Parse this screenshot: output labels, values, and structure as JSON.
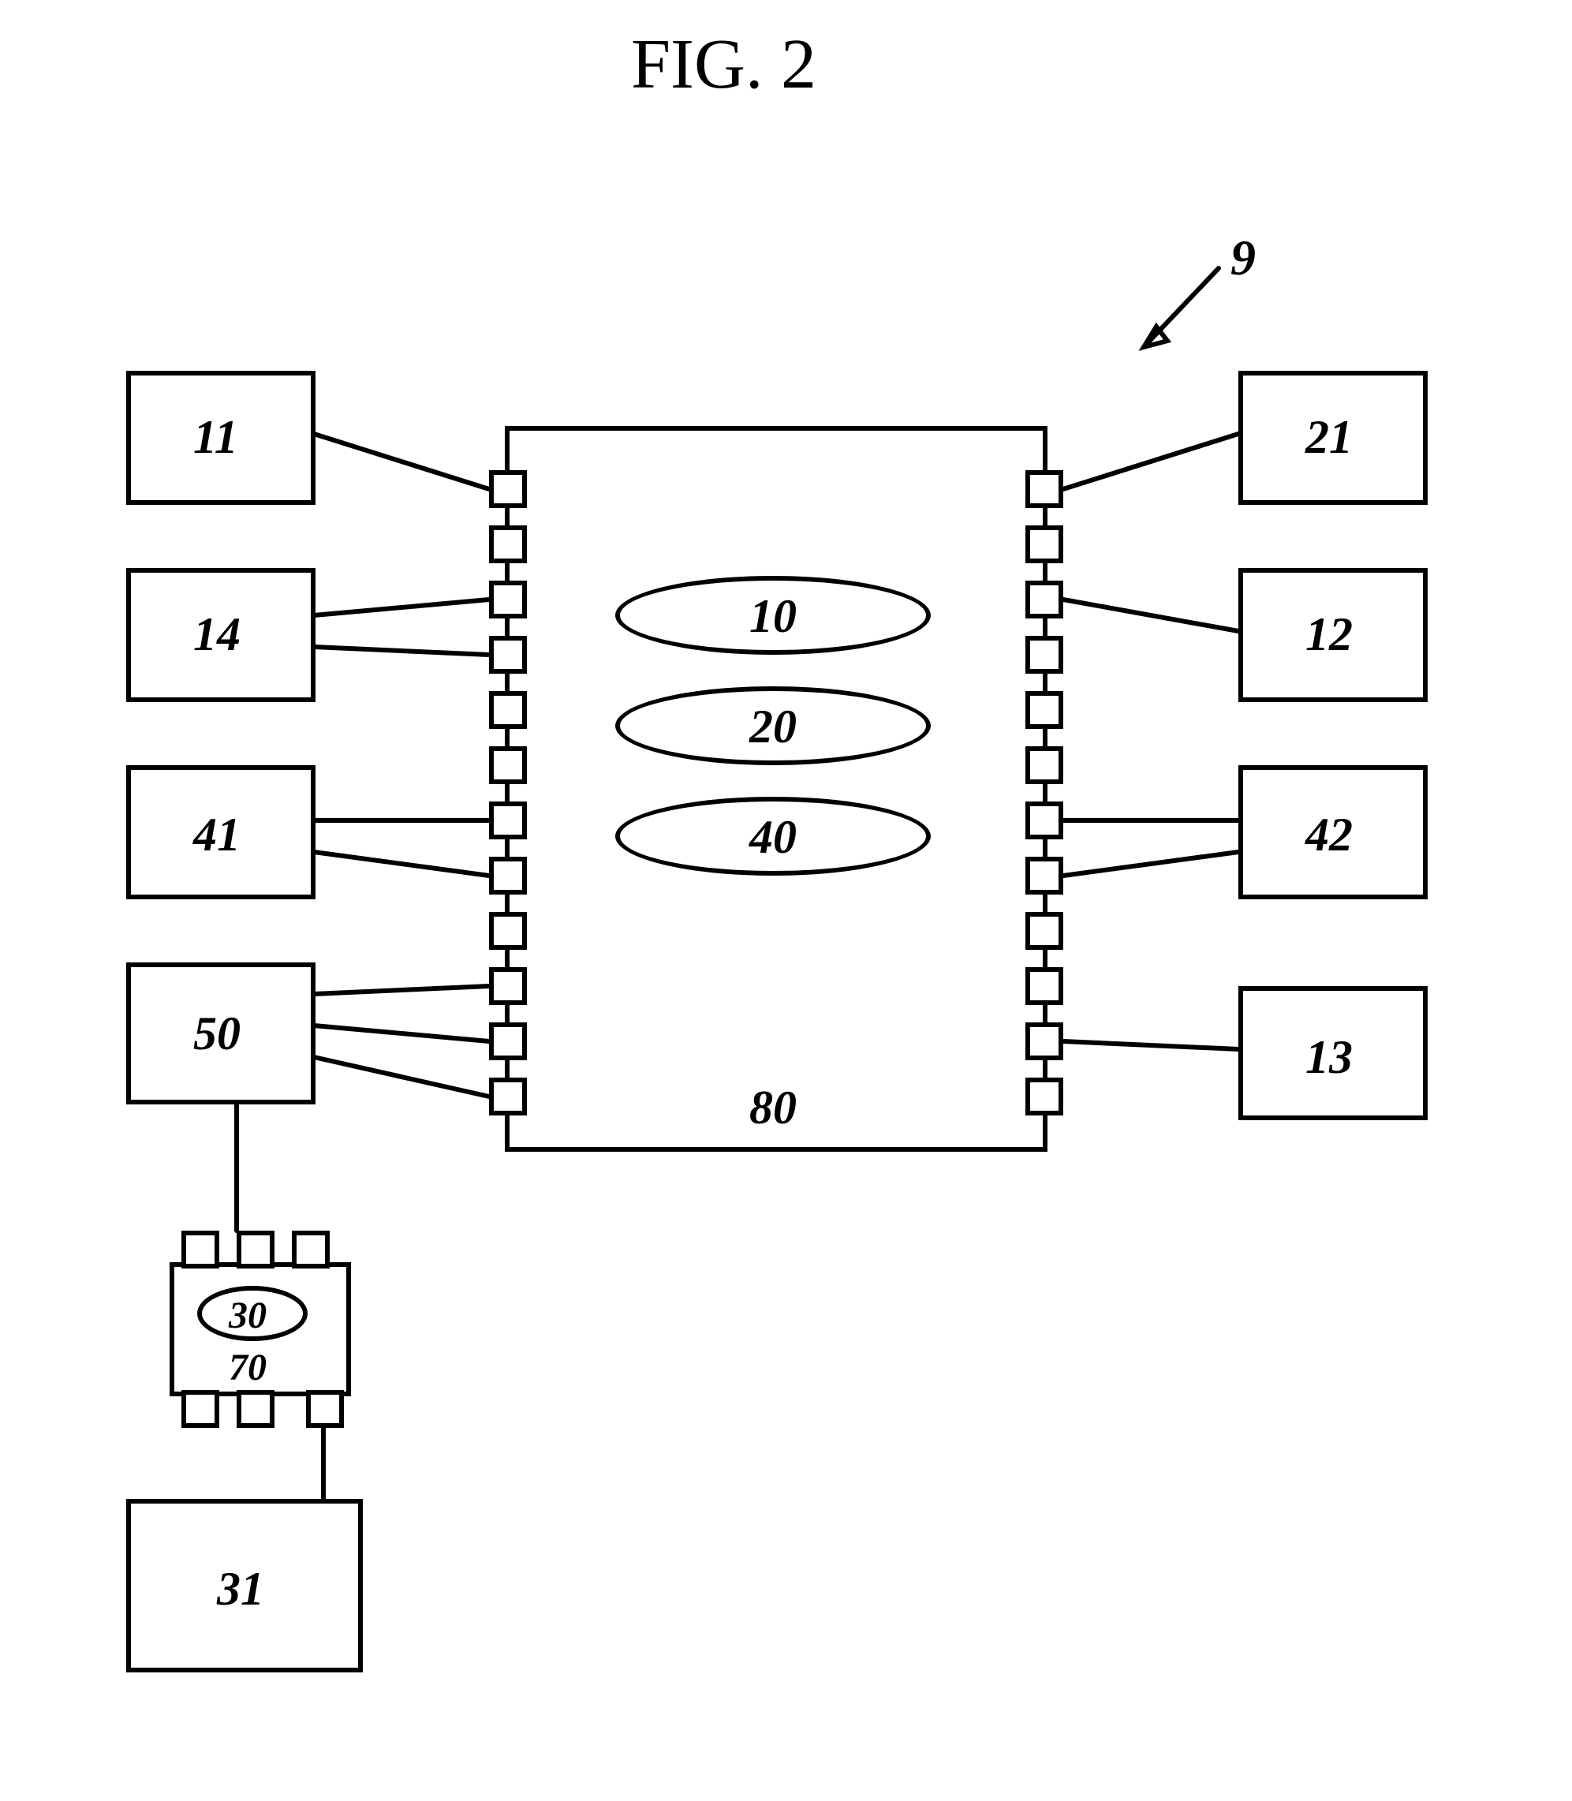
{
  "title": "FIG. 2",
  "assembly_label": "9",
  "left_boxes": {
    "b11": "11",
    "b14": "14",
    "b41": "41",
    "b50": "50",
    "b31": "31"
  },
  "right_boxes": {
    "b21": "21",
    "b12": "12",
    "b42": "42",
    "b13": "13"
  },
  "central_box_label": "80",
  "ellipses": {
    "e10": "10",
    "e20": "20",
    "e40": "40"
  },
  "small_module": {
    "ellipse_label": "30",
    "box_label": "70"
  }
}
